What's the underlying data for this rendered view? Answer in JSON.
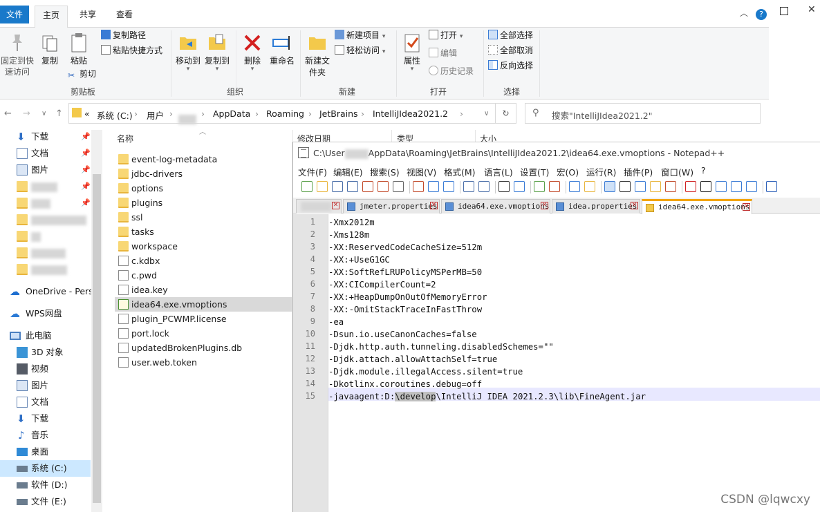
{
  "ribbon": {
    "tabs": [
      "文件",
      "主页",
      "共享",
      "查看"
    ],
    "help": "?",
    "clipboard": {
      "pin": "固定到快速访问",
      "copy": "复制",
      "paste": "粘贴",
      "copy_path": "复制路径",
      "paste_shortcut": "粘贴快捷方式",
      "cut": "剪切",
      "group": "剪贴板"
    },
    "organize": {
      "move_to": "移动到",
      "copy_to": "复制到",
      "delete": "删除",
      "rename": "重命名",
      "group": "组织"
    },
    "new": {
      "new_folder": "新建文件夹",
      "new_item": "新建项目",
      "easy_access": "轻松访问",
      "group": "新建"
    },
    "open": {
      "properties": "属性",
      "open": "打开",
      "edit": "编辑",
      "history": "历史记录",
      "group": "打开"
    },
    "select": {
      "select_all": "全部选择",
      "select_none": "全部取消",
      "invert": "反向选择",
      "group": "选择"
    }
  },
  "address": {
    "prefix": "«",
    "crumbs": [
      "系统 (C:)",
      "用户",
      "AppData",
      "Roaming",
      "JetBrains",
      "IntelliJIdea2021.2"
    ],
    "search_placeholder": "搜索\"IntelliJIdea2021.2\""
  },
  "nav": {
    "quick": [
      {
        "label": "下载",
        "color": "#2f6fc6"
      },
      {
        "label": "文档",
        "color": "#6d8bb8"
      },
      {
        "label": "图片",
        "color": "#5c7fb0"
      }
    ],
    "onedrive": "OneDrive - Perso",
    "wps": "WPS网盘",
    "pc": "此电脑",
    "pc_items": [
      {
        "label": "3D 对象",
        "color": "#3a94d6"
      },
      {
        "label": "视频",
        "color": "#555b66"
      },
      {
        "label": "图片",
        "color": "#5c7fb0"
      },
      {
        "label": "文档",
        "color": "#6d8bb8"
      },
      {
        "label": "下载",
        "color": "#2f6fc6"
      },
      {
        "label": "音乐",
        "color": "#2f6fc6"
      },
      {
        "label": "桌面",
        "color": "#2f8ad6"
      },
      {
        "label": "系统 (C:)",
        "color": "#6a7c8e"
      },
      {
        "label": "软件 (D:)",
        "color": "#6a7c8e"
      },
      {
        "label": "文件 (E:)",
        "color": "#6a7c8e"
      }
    ]
  },
  "file_list": {
    "columns": [
      "名称",
      "修改日期",
      "类型",
      "大小"
    ],
    "items": [
      {
        "name": "event-log-metadata",
        "kind": "folder"
      },
      {
        "name": "jdbc-drivers",
        "kind": "folder"
      },
      {
        "name": "options",
        "kind": "folder"
      },
      {
        "name": "plugins",
        "kind": "folder"
      },
      {
        "name": "ssl",
        "kind": "folder"
      },
      {
        "name": "tasks",
        "kind": "folder"
      },
      {
        "name": "workspace",
        "kind": "folder"
      },
      {
        "name": "c.kdbx",
        "kind": "file"
      },
      {
        "name": "c.pwd",
        "kind": "file"
      },
      {
        "name": "idea.key",
        "kind": "file"
      },
      {
        "name": "idea64.exe.vmoptions",
        "kind": "notepad",
        "selected": true
      },
      {
        "name": "plugin_PCWMP.license",
        "kind": "file"
      },
      {
        "name": "port.lock",
        "kind": "file"
      },
      {
        "name": "updatedBrokenPlugins.db",
        "kind": "file"
      },
      {
        "name": "user.web.token",
        "kind": "file"
      }
    ]
  },
  "notepad": {
    "title_pre": "C:\\User",
    "title_post": "AppData\\Roaming\\JetBrains\\IntelliJIdea2021.2\\idea64.exe.vmoptions - Notepad++",
    "menu": [
      "文件(F)",
      "编辑(E)",
      "搜索(S)",
      "视图(V)",
      "格式(M)",
      "语言(L)",
      "设置(T)",
      "宏(O)",
      "运行(R)",
      "插件(P)",
      "窗口(W)",
      "?"
    ],
    "tabs": [
      {
        "label": "jmeter.properties"
      },
      {
        "label": "idea64.exe.vmoptions"
      },
      {
        "label": "idea.properties"
      },
      {
        "label": "idea64.exe.vmoptions",
        "active": true
      }
    ],
    "lines": [
      "-Xmx2012m",
      "-Xms128m",
      "-XX:ReservedCodeCacheSize=512m",
      "-XX:+UseG1GC",
      "-XX:SoftRefLRUPolicyMSPerMB=50",
      "-XX:CICompilerCount=2",
      "-XX:+HeapDumpOnOutOfMemoryError",
      "-XX:-OmitStackTraceInFastThrow",
      "-ea",
      "-Dsun.io.useCanonCaches=false",
      "-Djdk.http.auth.tunneling.disabledSchemes=\"\"",
      "-Djdk.attach.allowAttachSelf=true",
      "-Djdk.module.illegalAccess.silent=true",
      "-Dkotlinx.coroutines.debug=off"
    ],
    "last_line": {
      "a": "-javaagent:D:",
      "sel": "\\develop",
      "b": "\\IntelliJ IDEA 2021.2.3\\lib\\FineAgent.jar"
    },
    "line_count": 15
  },
  "watermark": "CSDN @lqwcxy"
}
